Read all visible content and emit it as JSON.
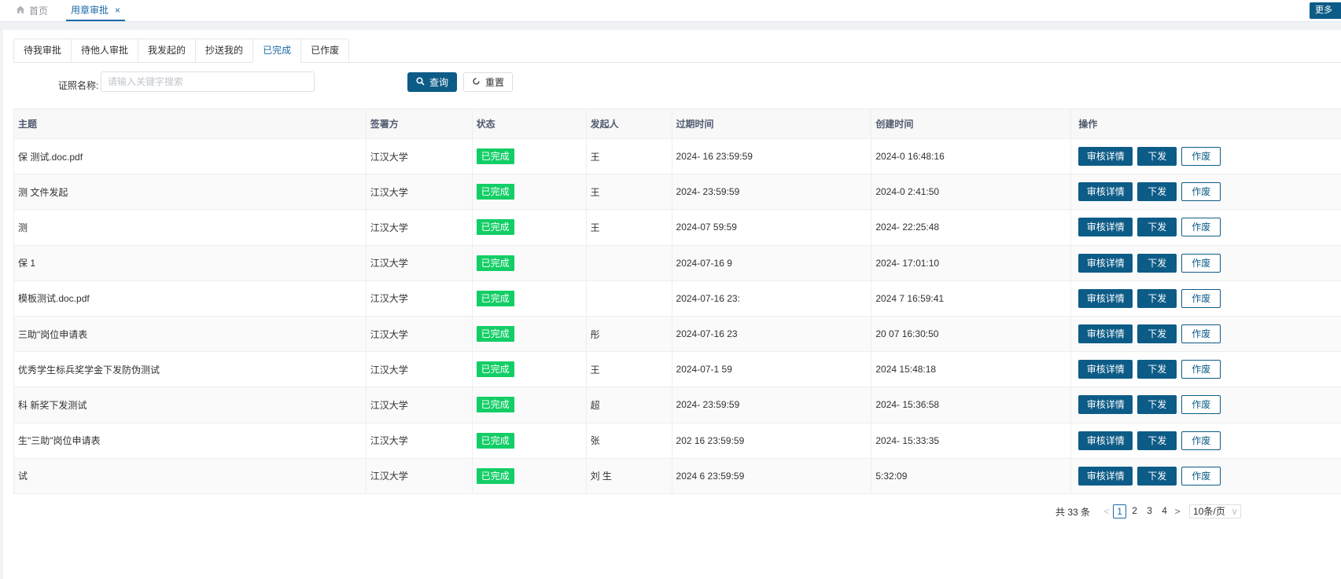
{
  "tagbar": {
    "home_label": "首页",
    "active_label": "用章审批",
    "close_symbol": "×",
    "more_label": "更多"
  },
  "tabs": [
    {
      "label": "待我审批"
    },
    {
      "label": "待他人审批"
    },
    {
      "label": "我发起的"
    },
    {
      "label": "抄送我的"
    },
    {
      "label": "已完成"
    },
    {
      "label": "已作废"
    }
  ],
  "selected_tab": "已完成",
  "search": {
    "label": "证照名称:",
    "placeholder": "请输入关键字搜索",
    "value": "",
    "query_label": "查询",
    "reset_label": "重置"
  },
  "table": {
    "headers": [
      "主题",
      "签署方",
      "状态",
      "发起人",
      "过期时间",
      "创建时间",
      "操作"
    ],
    "rows": [
      {
        "subject": "保 测试.doc.pdf",
        "party": "江汉大学",
        "status": "已完成",
        "initiator": "王",
        "expire": "2024- 16 23:59:59",
        "created": "2024-0 16:48:16"
      },
      {
        "subject": "测 文件发起",
        "party": "江汉大学",
        "status": "已完成",
        "initiator": "王",
        "expire": "2024- 23:59:59",
        "created": "2024-0 2:41:50"
      },
      {
        "subject": "测",
        "party": "江汉大学",
        "status": "已完成",
        "initiator": "王",
        "expire": "2024-07 59:59",
        "created": "2024- 22:25:48"
      },
      {
        "subject": "保 1",
        "party": "江汉大学",
        "status": "已完成",
        "initiator": "",
        "expire": "2024-07-16 9",
        "created": "2024- 17:01:10"
      },
      {
        "subject": "模板测试.doc.pdf",
        "party": "江汉大学",
        "status": "已完成",
        "initiator": "",
        "expire": "2024-07-16 23:",
        "created": "2024 7 16:59:41"
      },
      {
        "subject": "三助\"岗位申请表",
        "party": "江汉大学",
        "status": "已完成",
        "initiator": "彤",
        "expire": "2024-07-16 23",
        "created": "20 07 16:30:50"
      },
      {
        "subject": "优秀学生标兵奖学金下发防伪测试",
        "party": "江汉大学",
        "status": "已完成",
        "initiator": "王",
        "expire": "2024-07-1 59",
        "created": "2024 15:48:18"
      },
      {
        "subject": "科 新奖下发测试",
        "party": "江汉大学",
        "status": "已完成",
        "initiator": "超",
        "expire": "2024- 23:59:59",
        "created": "2024- 15:36:58"
      },
      {
        "subject": "生\"三助\"岗位申请表",
        "party": "江汉大学",
        "status": "已完成",
        "initiator": "张",
        "expire": "202 16 23:59:59",
        "created": "2024- 15:33:35"
      },
      {
        "subject": "试",
        "party": "江汉大学",
        "status": "已完成",
        "initiator": "刘 生",
        "expire": "2024 6 23:59:59",
        "created": "5:32:09"
      }
    ],
    "actions": {
      "detail": "审核详情",
      "issue": "下发",
      "void": "作废"
    }
  },
  "pagination": {
    "total_text": "共 33 条",
    "prev_symbol": "<",
    "next_symbol": ">",
    "pages": [
      "1",
      "2",
      "3",
      "4"
    ],
    "current_page": 1,
    "page_size_label": "10条/页",
    "chevron_symbol": "∨"
  },
  "colors": {
    "primary": "#0d5c87",
    "tab_active": "#1a6aa8",
    "status_done": "#13ce66"
  },
  "icons": {
    "home": "home-icon",
    "search": "search-icon",
    "reset": "refresh-icon"
  }
}
